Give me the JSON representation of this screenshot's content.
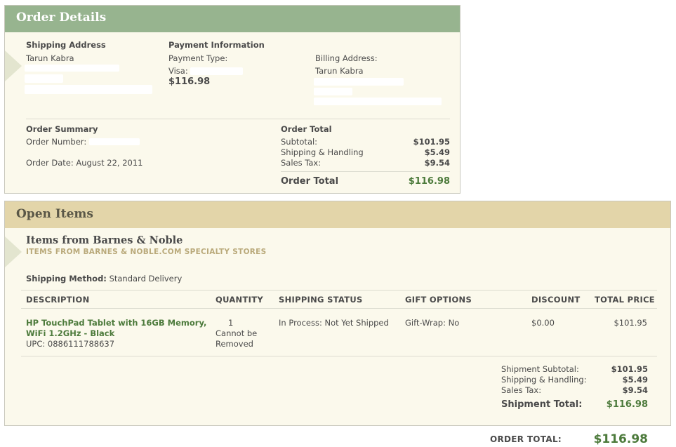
{
  "order_details": {
    "title": "Order Details",
    "shipping_address": {
      "heading": "Shipping Address",
      "name": "Tarun Kabra"
    },
    "payment": {
      "heading": "Payment Information",
      "type_label": "Payment Type:",
      "visa_label": "Visa:",
      "amount": "$116.98",
      "billing_label": "Billing Address:",
      "billing_name": "Tarun Kabra"
    },
    "summary": {
      "heading": "Order Summary",
      "number_label": "Order Number:",
      "date_label": "Order Date:",
      "date_value": "August 22, 2011"
    },
    "totals": {
      "heading": "Order Total",
      "subtotal_label": "Subtotal:",
      "subtotal_value": "$101.95",
      "shipping_label": "Shipping & Handling",
      "shipping_value": "$5.49",
      "tax_label": "Sales Tax:",
      "tax_value": "$9.54",
      "total_label": "Order Total",
      "total_value": "$116.98"
    }
  },
  "open_items": {
    "title": "Open Items",
    "store_title": "Items from Barnes & Noble",
    "store_subtitle": "ITEMS FROM BARNES & NOBLE.COM SPECIALTY STORES",
    "shipping_method_label": "Shipping Method:",
    "shipping_method_value": "Standard Delivery",
    "columns": [
      "DESCRIPTION",
      "QUANTITY",
      "SHIPPING STATUS",
      "GIFT OPTIONS",
      "DISCOUNT",
      "TOTAL PRICE"
    ],
    "item": {
      "name_line1": "HP TouchPad Tablet with 16GB Memory,",
      "name_line2": "WiFi 1.2GHz - Black",
      "upc": "UPC: 0886111788637",
      "quantity": "1",
      "quantity_note_line1": "Cannot be",
      "quantity_note_line2": "Removed",
      "shipping_status": "In Process: Not Yet Shipped",
      "gift_options": "Gift-Wrap: No",
      "discount": "$0.00",
      "total_price": "$101.95"
    },
    "shipment": {
      "subtotal_label": "Shipment Subtotal:",
      "subtotal_value": "$101.95",
      "shipping_label": "Shipping & Handling:",
      "shipping_value": "$5.49",
      "tax_label": "Sales Tax:",
      "tax_value": "$9.54",
      "total_label": "Shipment Total:",
      "total_value": "$116.98"
    }
  },
  "grand_total": {
    "label": "ORDER TOTAL:",
    "value": "$116.98"
  }
}
